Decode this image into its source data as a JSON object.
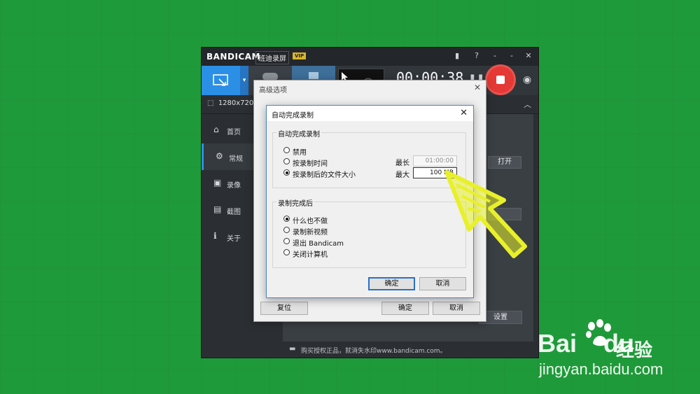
{
  "app": {
    "brand": "BANDICAM",
    "brand_cn": "班迪录屏",
    "vip": "VIP",
    "timer": "00:00:38",
    "resolution": "1280x720 -",
    "sidebar": [
      {
        "label": "首页",
        "icon": "home-icon"
      },
      {
        "label": "常规",
        "icon": "gear-icon"
      },
      {
        "label": "录像",
        "icon": "video-icon"
      },
      {
        "label": "截图",
        "icon": "image-icon"
      },
      {
        "label": "关于",
        "icon": "info-icon"
      }
    ],
    "open_button": "打开",
    "settings_button": "设置",
    "footer": "购买授权正品，就消失水印www.bandicam.com。"
  },
  "advanced": {
    "title": "高级选项",
    "reset": "复位",
    "ok": "确定",
    "cancel": "取消"
  },
  "dialog": {
    "title": "自动完成录制",
    "group1_title": "自动完成录制",
    "options1": [
      "禁用",
      "按录制时间",
      "按录制后的文件大小"
    ],
    "selected1": 2,
    "max_length_label": "最长",
    "max_length_value": "01:00:00",
    "max_size_label": "最大",
    "max_size_value": "100 MB",
    "group2_title": "录制完成后",
    "options2": [
      "什么也不做",
      "录制新视频",
      "退出 Bandicam",
      "关闭计算机"
    ],
    "selected2": 0,
    "ok": "确定",
    "cancel": "取消"
  },
  "watermark": {
    "logo": "Bai",
    "logo2": "du",
    "sub": "经验",
    "url": "jingyan.baidu.com"
  },
  "colors": {
    "background": "#1f9a3a",
    "accent": "#2b8fe6",
    "record": "#e53935",
    "arrow": "#e8f02a"
  }
}
